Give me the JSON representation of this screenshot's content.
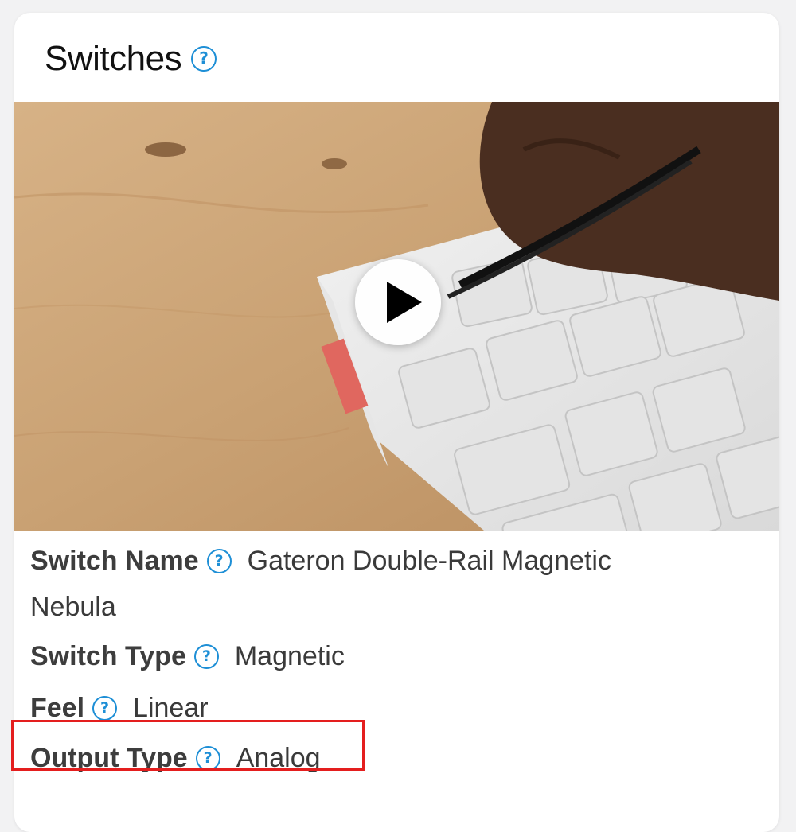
{
  "card": {
    "title": "Switches",
    "help_glyph": "?"
  },
  "video": {
    "thumbnail_description_icon": "play-icon"
  },
  "specs": [
    {
      "label": "Switch Name",
      "value_line1": "Gateron Double-Rail Magnetic",
      "value_line2": "Nebula"
    },
    {
      "label": "Switch Type",
      "value": "Magnetic"
    },
    {
      "label": "Feel",
      "value": "Linear"
    },
    {
      "label": "Output Type",
      "value": "Analog"
    }
  ],
  "colors": {
    "accent": "#1e8fd6",
    "highlight": "#e41e1e"
  }
}
